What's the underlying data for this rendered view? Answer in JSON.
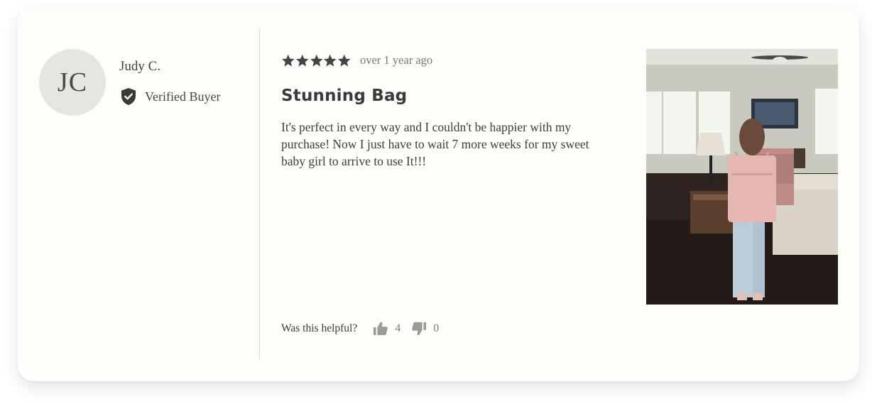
{
  "author": {
    "initials": "JC",
    "name": "Judy C.",
    "badge": "Verified Buyer"
  },
  "review": {
    "rating": 5,
    "max_rating": 5,
    "date": "over 1 year ago",
    "title": "Stunning Bag",
    "body": "It's perfect in every way and I couldn't be happier with my purchase! Now I just have to wait 7 more weeks for my sweet baby girl to arrive to use It!!!"
  },
  "helpful": {
    "prompt": "Was this helpful?",
    "up_count": "4",
    "down_count": "0"
  },
  "icons": {
    "star": "star-icon",
    "verified": "shield-check-icon",
    "thumbs_up": "thumbs-up-icon",
    "thumbs_down": "thumbs-down-icon"
  },
  "colors": {
    "card_background": "#fdfdf9",
    "avatar_background": "#e6e5e1",
    "star": "#454545",
    "vote_icon": "#9a9a9a"
  }
}
